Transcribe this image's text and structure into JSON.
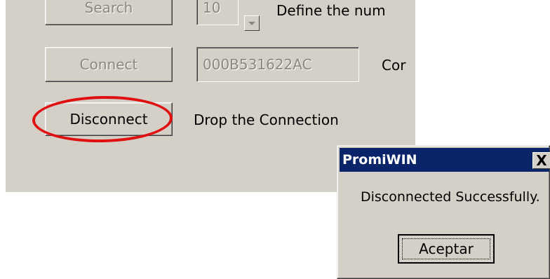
{
  "main": {
    "search_label": "Search",
    "count_value": "10",
    "count_desc": "Define the num",
    "connect_label": "Connect",
    "address_value": "000B531622AC",
    "connect_desc": "Cor",
    "disconnect_label": "Disconnect",
    "disconnect_desc": "Drop the Connection"
  },
  "dialog": {
    "title": "PromiWIN",
    "close": "X",
    "message": "Disconnected Successfully.",
    "ok_label": "Aceptar"
  },
  "colors": {
    "highlight": "#e01010",
    "titlebar": "#0a246a",
    "window_bg": "#d4d0c8"
  },
  "icons": {
    "spin_down": "chevron-down-icon",
    "close": "close-icon"
  }
}
